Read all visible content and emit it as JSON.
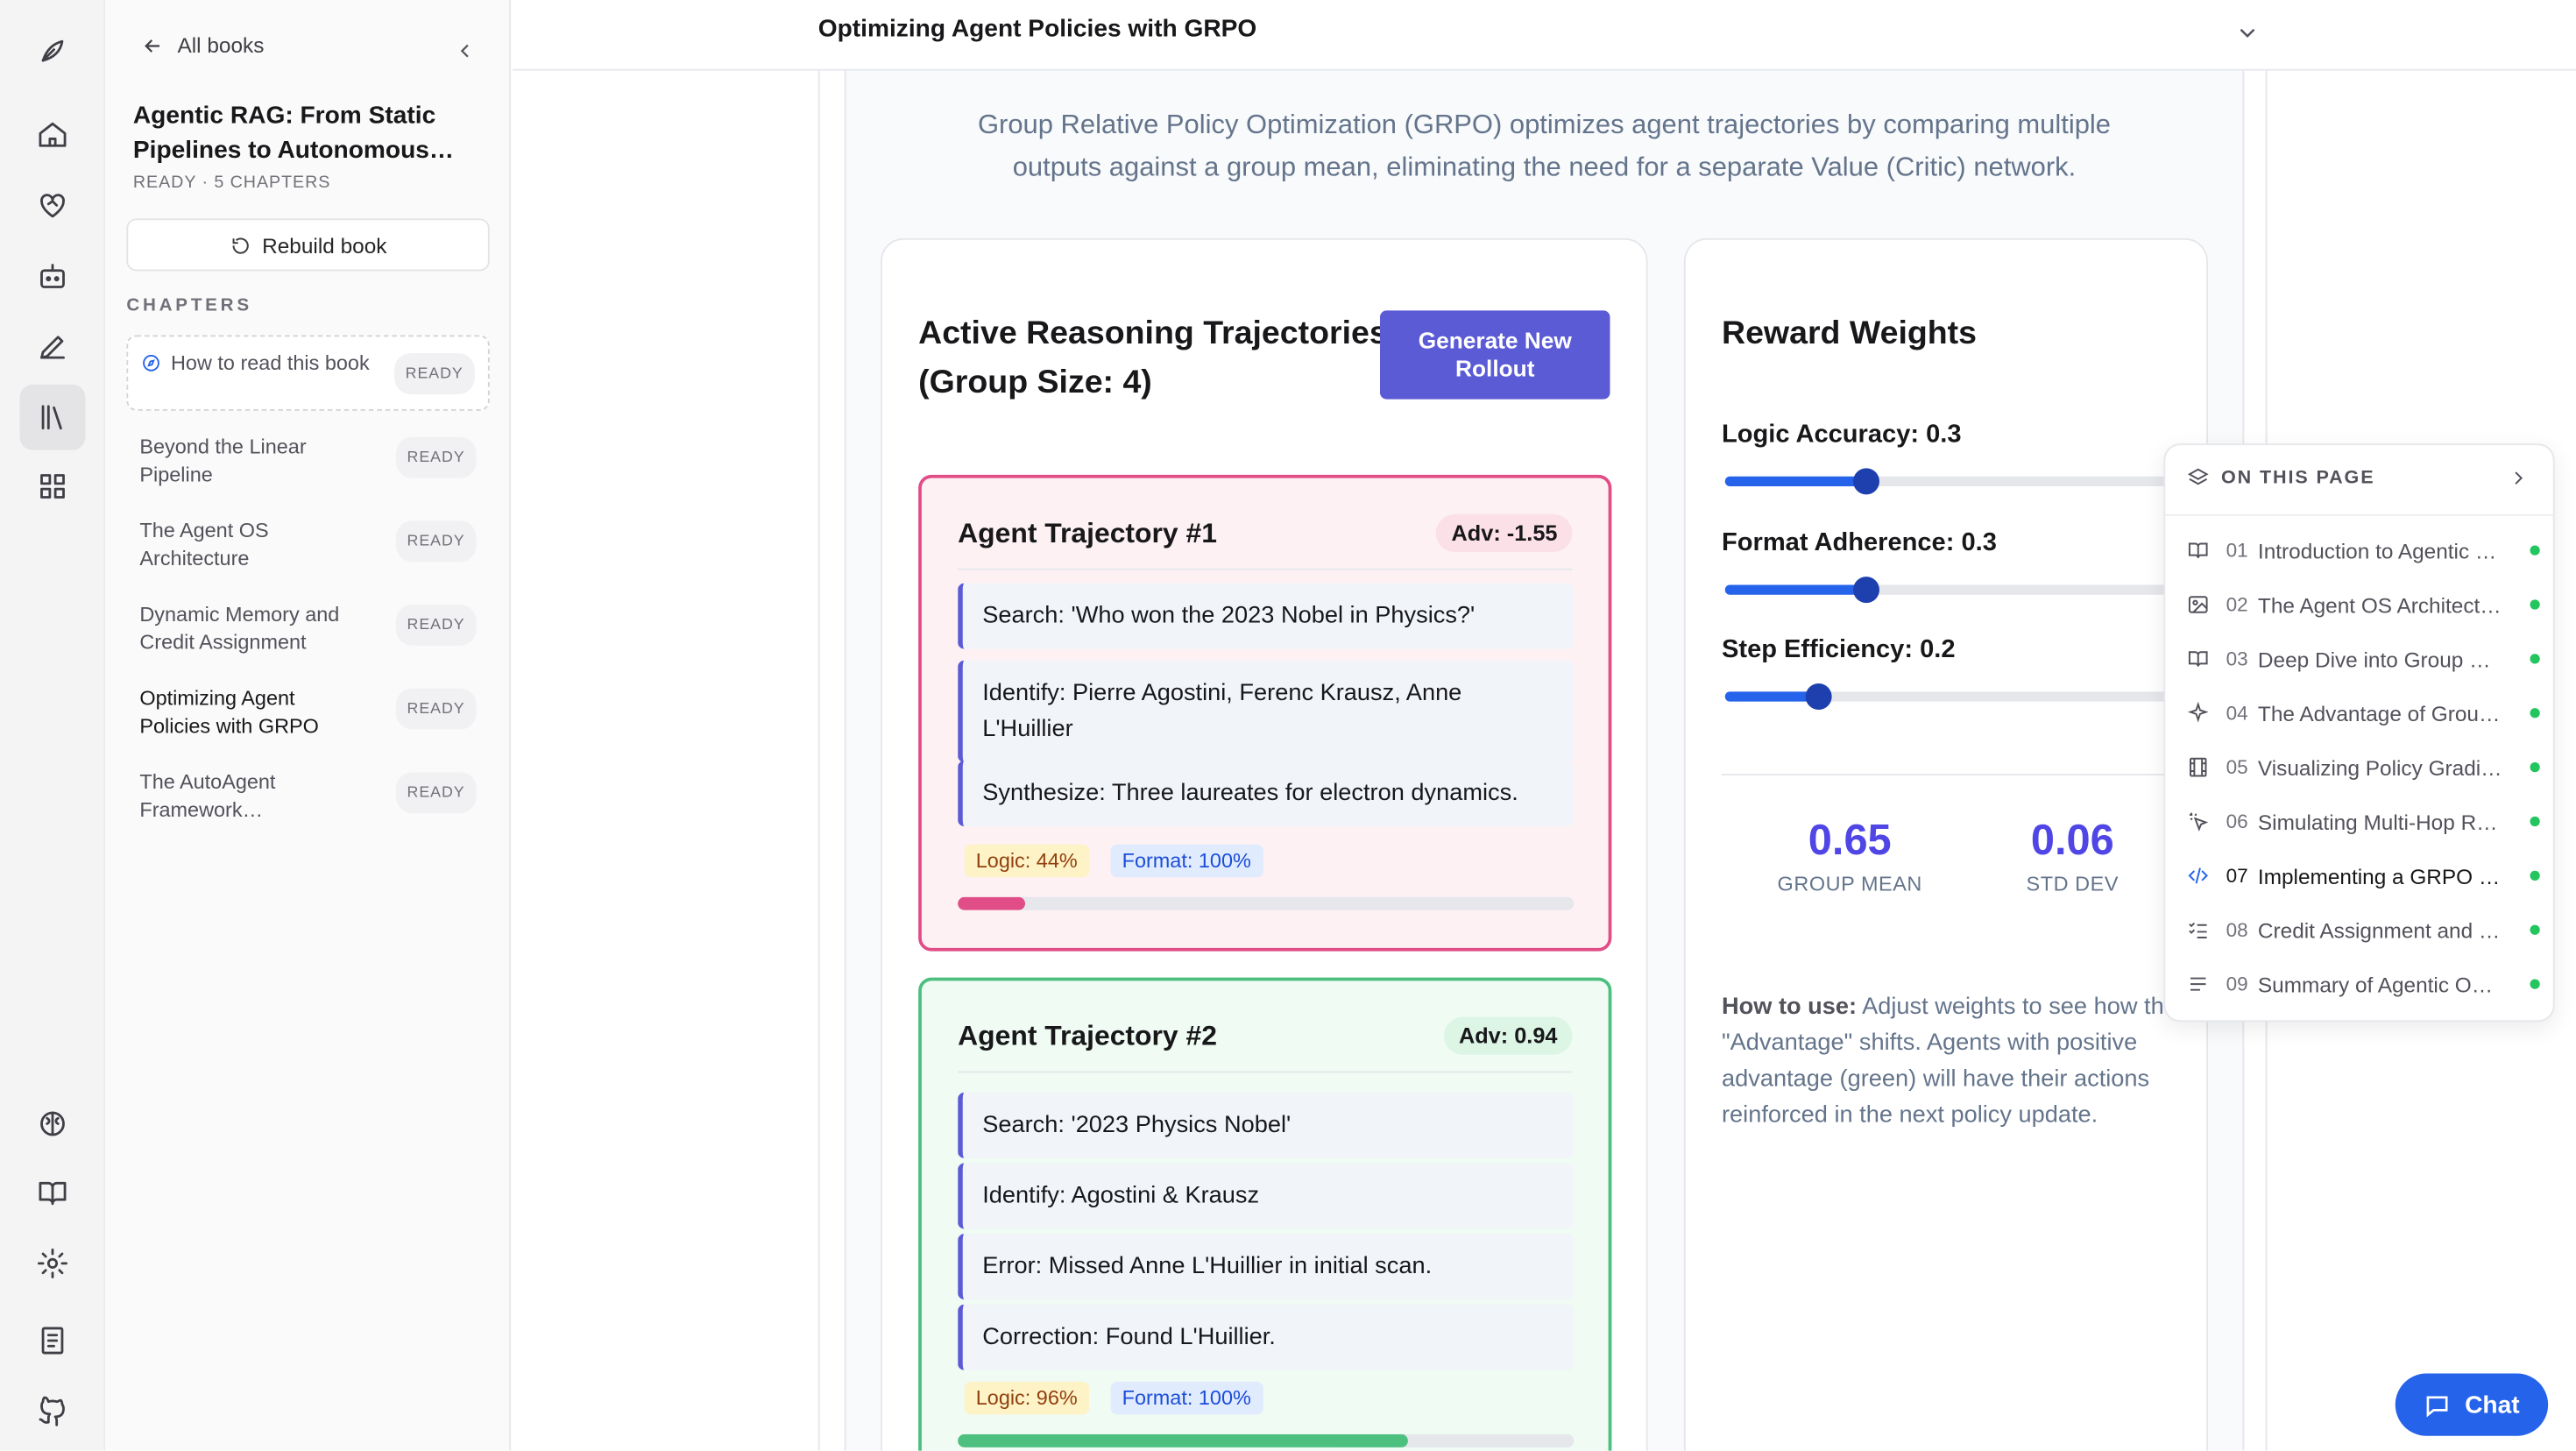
{
  "topbar": {
    "title": "Optimizing Agent Policies with GRPO"
  },
  "sidebar": {
    "back_label": "All books",
    "book_title": "Agentic RAG: From Static Pipelines to Autonomous…",
    "book_meta": "READY · 5 CHAPTERS",
    "rebuild_label": "Rebuild book",
    "chapters_heading": "CHAPTERS",
    "chapters": [
      {
        "label": "How to read this book",
        "status": "READY"
      },
      {
        "label": "Beyond the Linear Pipeline",
        "status": "READY"
      },
      {
        "label": "The Agent OS Architecture",
        "status": "READY"
      },
      {
        "label": "Dynamic Memory and Credit Assignment",
        "status": "READY"
      },
      {
        "label": "Optimizing Agent Policies with GRPO",
        "status": "READY"
      },
      {
        "label": "The AutoAgent Framework…",
        "status": "READY"
      }
    ]
  },
  "intro": "Group Relative Policy Optimization (GRPO) optimizes agent trajectories by comparing multiple outputs against a group mean, eliminating the need for a separate Value (Critic) network.",
  "trajectories": {
    "heading": "Active Reasoning Trajectories (Group Size: 4)",
    "generate_label": "Generate New Rollout",
    "items": [
      {
        "title": "Agent Trajectory #1",
        "adv": "Adv: -1.55",
        "steps": [
          "Search: 'Who won the 2023 Nobel in Physics?'",
          "Identify: Pierre Agostini, Ferenc Krausz, Anne L'Huillier",
          "Synthesize: Three laureates for electron dynamics."
        ],
        "logic": "Logic: 44%",
        "format": "Format: 100%",
        "progress": 0.11,
        "color": "#e14d86"
      },
      {
        "title": "Agent Trajectory #2",
        "adv": "Adv: 0.94",
        "steps": [
          "Search: '2023 Physics Nobel'",
          "Identify: Agostini & Krausz",
          "Error: Missed Anne L'Huillier in initial scan.",
          "Correction: Found L'Huillier."
        ],
        "logic": "Logic: 96%",
        "format": "Format: 100%",
        "progress": 0.73,
        "color": "#4dbf7f"
      }
    ]
  },
  "rewards": {
    "heading": "Reward Weights",
    "sliders": [
      {
        "label": "Logic Accuracy: 0.3",
        "value": 0.3
      },
      {
        "label": "Format Adherence: 0.3",
        "value": 0.3
      },
      {
        "label": "Step Efficiency: 0.2",
        "value": 0.2
      }
    ],
    "group_mean_value": "0.65",
    "group_mean_label": "GROUP MEAN",
    "std_dev_value": "0.06",
    "std_dev_label": "STD DEV",
    "howto_bold": "How to use:",
    "howto_text": " Adjust weights to see how the \"Advantage\" shifts. Agents with positive advantage (green) will have their actions reinforced in the next policy update."
  },
  "on_this_page": {
    "heading": "ON THIS PAGE",
    "items": [
      {
        "num": "01",
        "label": "Introduction to Agentic …",
        "icon": "book-icon"
      },
      {
        "num": "02",
        "label": "The Agent OS Architect…",
        "icon": "image-icon"
      },
      {
        "num": "03",
        "label": "Deep Dive into Group R…",
        "icon": "book-icon"
      },
      {
        "num": "04",
        "label": "The Advantage of Grou…",
        "icon": "sparkle-icon"
      },
      {
        "num": "05",
        "label": "Visualizing Policy Gradi…",
        "icon": "film-icon"
      },
      {
        "num": "06",
        "label": "Simulating Multi-Hop R…",
        "icon": "click-icon"
      },
      {
        "num": "07",
        "label": "Implementing a GRPO …",
        "icon": "code-icon"
      },
      {
        "num": "08",
        "label": "Credit Assignment and …",
        "icon": "checklist-icon"
      },
      {
        "num": "09",
        "label": "Summary of Agentic O…",
        "icon": "text-icon"
      }
    ]
  },
  "chat_label": "Chat"
}
